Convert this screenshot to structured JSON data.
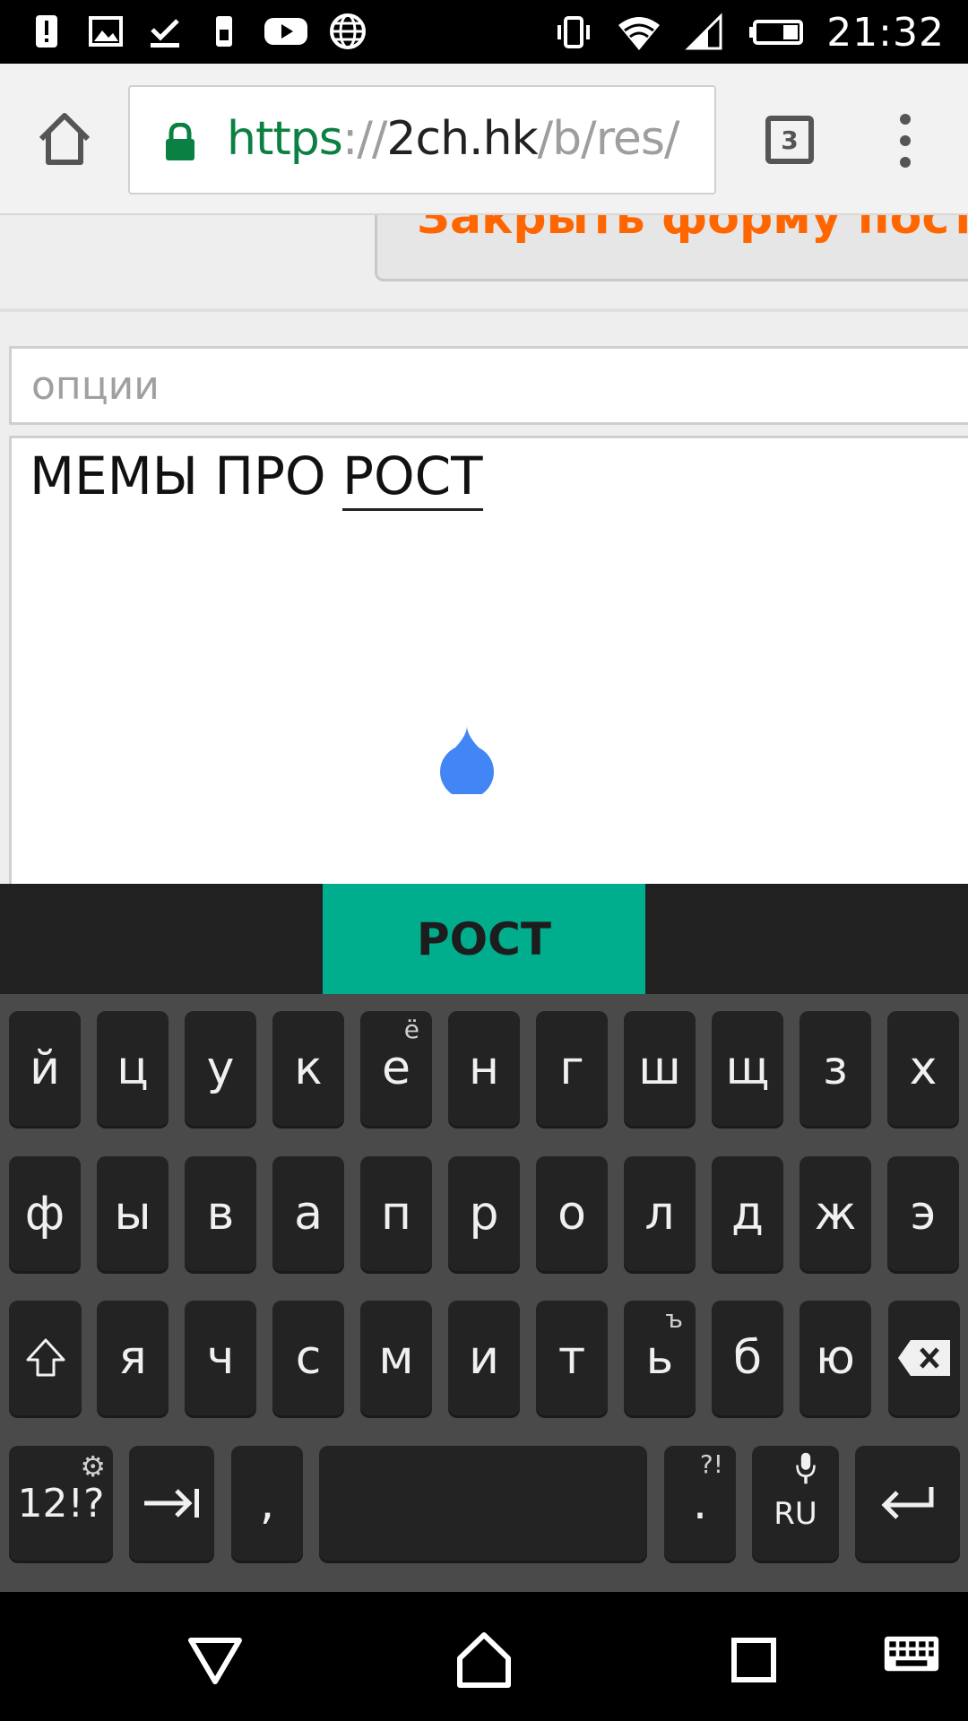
{
  "status_bar": {
    "time": "21:32",
    "left_icons": [
      "alert-icon",
      "image-icon",
      "download-done-icon",
      "sim-icon",
      "youtube-icon",
      "globe-icon"
    ],
    "right_icons": [
      "vibrate-icon",
      "wifi-icon",
      "signal-icon",
      "battery-icon"
    ]
  },
  "browser": {
    "url_scheme": "https",
    "url_sep": "://",
    "url_host": "2ch.hk",
    "url_path": "/b/res/",
    "tab_count": "3"
  },
  "page": {
    "close_form_label": "Закрыть форму пости",
    "options_placeholder": "опции",
    "text_prefix": "МЕМЫ ПРО ",
    "text_word": "РОСТ"
  },
  "keyboard": {
    "suggestion": "РОСТ",
    "row1": [
      {
        "label": "й"
      },
      {
        "label": "ц"
      },
      {
        "label": "у"
      },
      {
        "label": "к"
      },
      {
        "label": "е",
        "hint": "ё"
      },
      {
        "label": "н"
      },
      {
        "label": "г"
      },
      {
        "label": "ш"
      },
      {
        "label": "щ"
      },
      {
        "label": "з"
      },
      {
        "label": "х"
      }
    ],
    "row2": [
      {
        "label": "ф"
      },
      {
        "label": "ы"
      },
      {
        "label": "в"
      },
      {
        "label": "а"
      },
      {
        "label": "п"
      },
      {
        "label": "р"
      },
      {
        "label": "о"
      },
      {
        "label": "л"
      },
      {
        "label": "д"
      },
      {
        "label": "ж"
      },
      {
        "label": "э"
      }
    ],
    "row3": [
      {
        "label": "я"
      },
      {
        "label": "ч"
      },
      {
        "label": "с"
      },
      {
        "label": "м"
      },
      {
        "label": "и"
      },
      {
        "label": "т"
      },
      {
        "label": "ь",
        "hint": "ъ"
      },
      {
        "label": "б"
      },
      {
        "label": "ю"
      }
    ],
    "symbols_label": "12!?",
    "comma_label": ",",
    "period_label": ".",
    "period_hint": "?!",
    "language_label": "RU"
  },
  "colors": {
    "accent_orange": "#ff6600",
    "suggestion_bg": "#00ad8d",
    "url_green": "#0b8043",
    "cursor_blue": "#4285f4"
  }
}
